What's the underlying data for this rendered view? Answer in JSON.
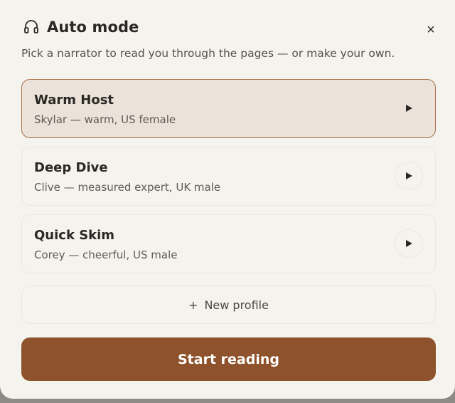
{
  "dialog": {
    "title": "Auto mode",
    "title_icon": "headphones-icon",
    "close_label": "×",
    "subtitle": "Pick a narrator to read you through the pages — or make your own."
  },
  "profiles": [
    {
      "name": "Warm Host",
      "description": "Skylar — warm, US female",
      "selected": true
    },
    {
      "name": "Deep Dive",
      "description": "Clive — measured expert, UK male",
      "selected": false
    },
    {
      "name": "Quick Skim",
      "description": "Corey — cheerful, US male",
      "selected": false
    }
  ],
  "new_profile": {
    "icon": "+",
    "label": "New profile"
  },
  "start_button": {
    "label": "Start reading"
  },
  "colors": {
    "accent": "#8e532c",
    "selected_bg": "#ebe2d9",
    "selected_border": "#a8704a",
    "panel_bg": "#f5f3ee"
  }
}
